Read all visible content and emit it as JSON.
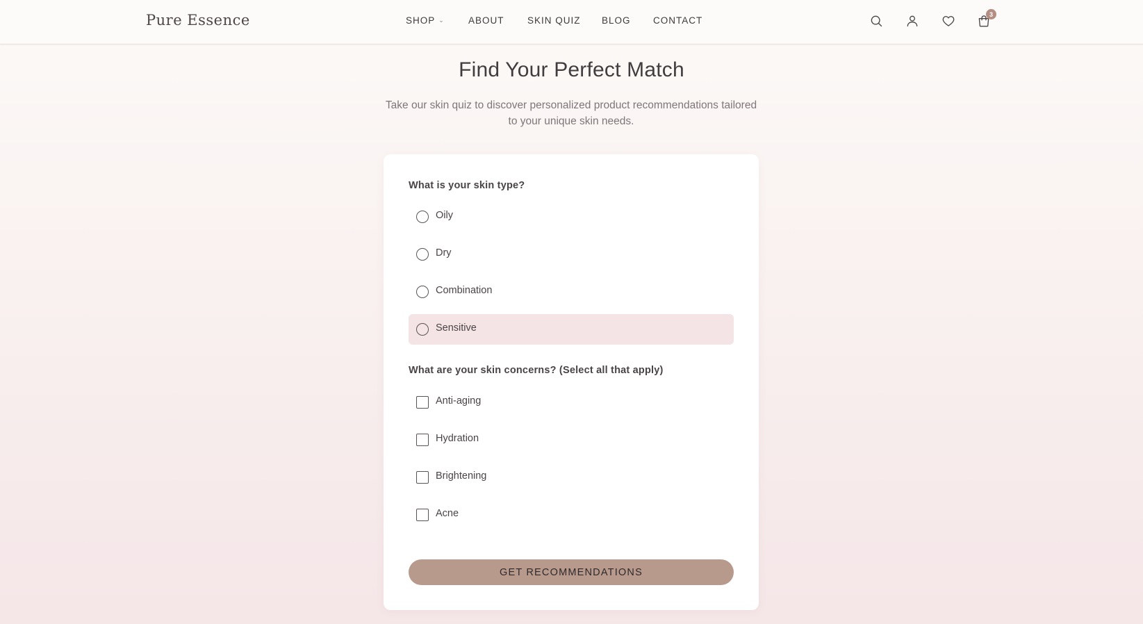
{
  "brand": {
    "name": "Pure Essence"
  },
  "nav": {
    "shop": "SHOP",
    "about": "ABOUT",
    "skin_quiz": "SKIN QUIZ",
    "blog": "BLOG",
    "contact": "CONTACT"
  },
  "header_icons": {
    "search": "search-icon",
    "account": "user-icon",
    "wishlist": "heart-icon",
    "cart": "shopping-bag-icon",
    "cart_count": "3"
  },
  "hero": {
    "title": "Find Your Perfect Match",
    "subtitle": "Take our skin quiz to discover personalized product recommendations tailored to your unique skin needs."
  },
  "quiz": {
    "skin_type": {
      "question": "What is your skin type?",
      "options": [
        {
          "label": "Oily",
          "selected": false
        },
        {
          "label": "Dry",
          "selected": false
        },
        {
          "label": "Combination",
          "selected": false
        },
        {
          "label": "Sensitive",
          "selected": false,
          "highlighted": true
        }
      ]
    },
    "concerns": {
      "question": "What are your skin concerns? (Select all that apply)",
      "options": [
        {
          "label": "Anti-aging",
          "checked": false
        },
        {
          "label": "Hydration",
          "checked": false
        },
        {
          "label": "Brightening",
          "checked": false
        },
        {
          "label": "Acne",
          "checked": false
        }
      ]
    },
    "submit_label": "GET RECOMMENDATIONS"
  },
  "colors": {
    "accent": "#b89a8d",
    "highlight": "#f4e4e5",
    "badge": "#b48e82",
    "text": "#4a4446"
  }
}
